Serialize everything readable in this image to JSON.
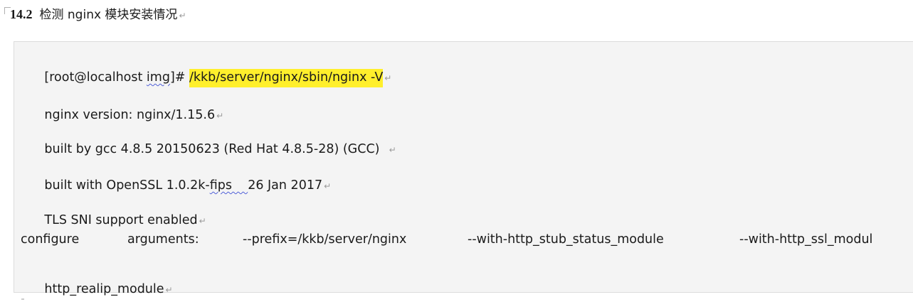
{
  "heading": {
    "number": "14.2",
    "title": "检测 nginx 模块安装情况"
  },
  "para_mark": "↵",
  "code": {
    "line1": {
      "prompt_prefix": "[root@localhost ",
      "prompt_dir": "img",
      "prompt_suffix": "]# ",
      "command": "/kkb/server/nginx/sbin/nginx -V"
    },
    "line2": "nginx version: nginx/1.15.6",
    "line3": "built by gcc 4.8.5 20150623 (Red Hat 4.8.5-28) (GCC)  ",
    "line4": {
      "prefix": "built with OpenSSL 1.0.2k-",
      "underlined": "fips    ",
      "suffix": "26 Jan 2017"
    },
    "line5": "TLS SNI support enabled",
    "line6": {
      "w1": "configure",
      "w2": "arguments:",
      "w3": "--prefix=/kkb/server/nginx",
      "w4": "--with-http_stub_status_module",
      "w5": "--with-http_ssl_modul"
    },
    "line7": "http_realip_module"
  }
}
